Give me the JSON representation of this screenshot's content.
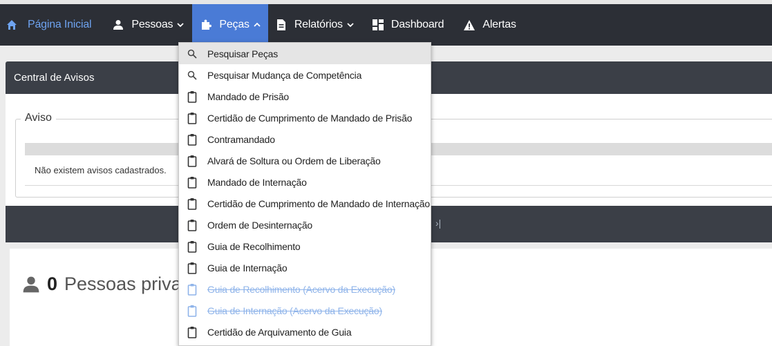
{
  "navbar": {
    "items": [
      {
        "label": "Página Inicial",
        "icon": "home-icon"
      },
      {
        "label": "Pessoas",
        "icon": "person-icon",
        "caret": "chevron-down-icon"
      },
      {
        "label": "Peças",
        "icon": "puzzle-icon",
        "caret": "chevron-up-icon",
        "active": true
      },
      {
        "label": "Relatórios",
        "icon": "document-icon",
        "caret": "chevron-down-icon"
      },
      {
        "label": "Dashboard",
        "icon": "dashboard-icon"
      },
      {
        "label": "Alertas",
        "icon": "warning-icon"
      }
    ]
  },
  "panel": {
    "title": "Central de Avisos",
    "legend": "Aviso",
    "empty_message": "Não existem avisos cadastrados.",
    "pager_last": "›|"
  },
  "stats": {
    "count": "0",
    "label": "Pessoas privadas de"
  },
  "dropdown": {
    "items": [
      {
        "label": "Pesquisar Peças",
        "icon": "search-icon"
      },
      {
        "label": "Pesquisar Mudança de Competência",
        "icon": "search-icon"
      },
      {
        "label": "Mandado de Prisão",
        "icon": "clipboard-icon"
      },
      {
        "label": "Certidão de Cumprimento de Mandado de Prisão",
        "icon": "clipboard-icon"
      },
      {
        "label": "Contramandado",
        "icon": "clipboard-icon"
      },
      {
        "label": "Alvará de Soltura ou Ordem de Liberação",
        "icon": "clipboard-icon"
      },
      {
        "label": "Mandado de Internação",
        "icon": "clipboard-icon"
      },
      {
        "label": "Certidão de Cumprimento de Mandado de Internação",
        "icon": "clipboard-icon"
      },
      {
        "label": "Ordem de Desinternação",
        "icon": "clipboard-icon"
      },
      {
        "label": "Guia de Recolhimento",
        "icon": "clipboard-icon"
      },
      {
        "label": "Guia de Internação",
        "icon": "clipboard-icon"
      },
      {
        "label": "Guia de Recolhimento (Acervo da Execução)",
        "icon": "clipboard-icon",
        "disabled": true
      },
      {
        "label": "Guia de Internação (Acervo da Execução)",
        "icon": "clipboard-icon",
        "disabled": true
      },
      {
        "label": "Certidão de Arquivamento de Guia",
        "icon": "clipboard-icon"
      }
    ]
  },
  "colors": {
    "navbar_bg": "#2c2f36",
    "active_tab": "#4a7bd6",
    "panel_header": "#3b3f47",
    "disabled_link": "#8fb4ea"
  }
}
